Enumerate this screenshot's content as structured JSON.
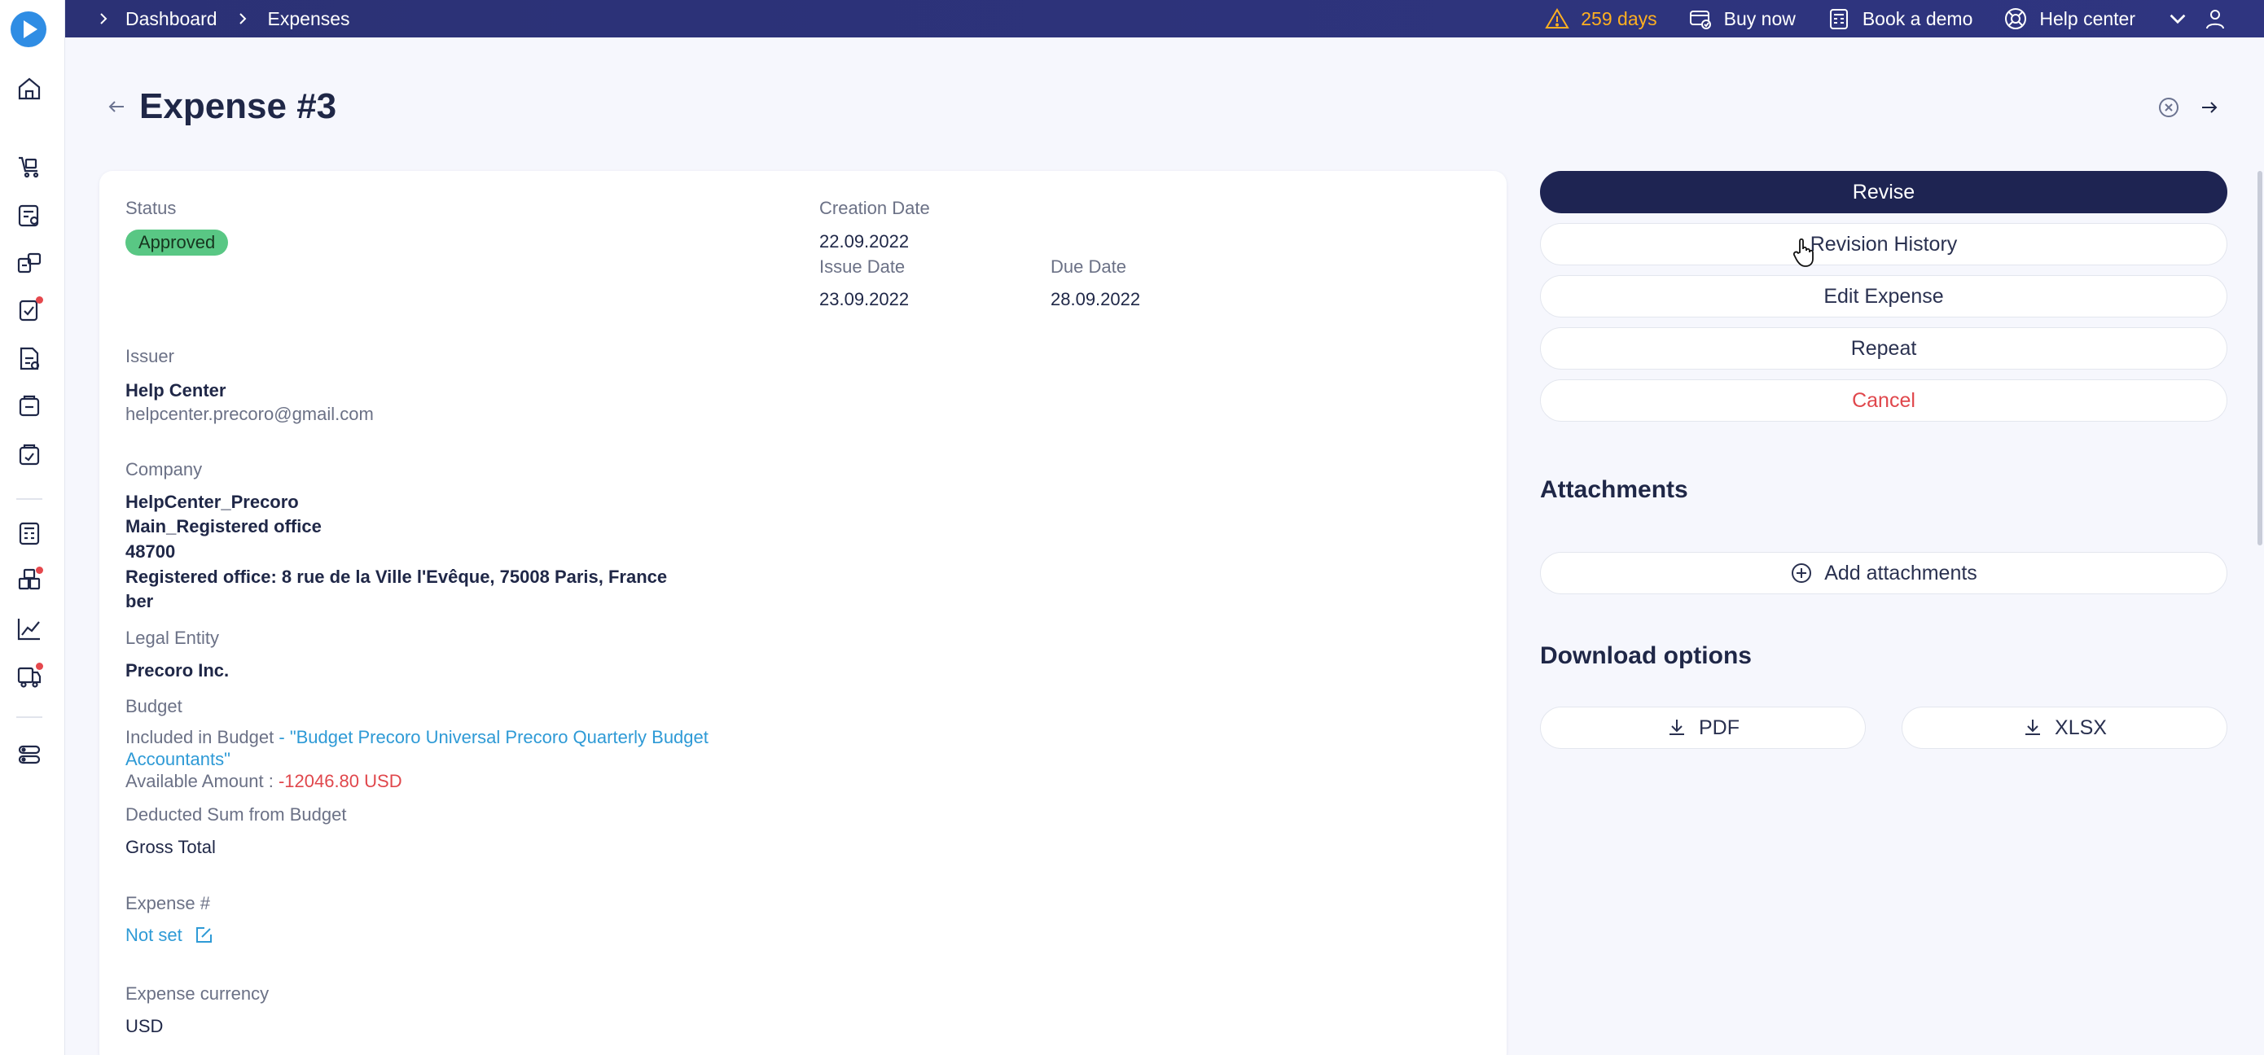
{
  "breadcrumbs": [
    "Dashboard",
    "Expenses"
  ],
  "topbar": {
    "trial_days": "259 days",
    "buy_now": "Buy now",
    "book_demo": "Book a demo",
    "help_center": "Help center"
  },
  "page": {
    "title": "Expense #3"
  },
  "details": {
    "status_label": "Status",
    "status_value": "Approved",
    "creation_date_label": "Creation Date",
    "creation_date": "22.09.2022",
    "issue_date_label": "Issue Date",
    "issue_date": "23.09.2022",
    "due_date_label": "Due Date",
    "due_date": "28.09.2022",
    "issuer_label": "Issuer",
    "issuer_name": "Help Center",
    "issuer_email": "helpcenter.precoro@gmail.com",
    "company_label": "Company",
    "company_lines": [
      "HelpCenter_Precoro",
      "Main_Registered office",
      "48700",
      "Registered office: 8 rue de la Ville l'Evêque, 75008 Paris, France",
      "ber"
    ],
    "legal_entity_label": "Legal Entity",
    "legal_entity": "Precoro Inc.",
    "budget_label": "Budget",
    "budget_prefix": "Included in Budget ",
    "budget_name_line1": "- \"Budget Precoro Universal Precoro Quarterly Budget",
    "budget_name_line2": "Accountants\"",
    "available_label": "Available Amount : ",
    "available_amount": "-12046.80 USD",
    "deducted_label": "Deducted Sum from Budget",
    "deducted_value": "Gross Total",
    "expense_no_label": "Expense #",
    "expense_no_value": "Not set",
    "currency_label": "Expense currency",
    "currency_value": "USD"
  },
  "actions": {
    "revise": "Revise",
    "revision_history": "Revision History",
    "edit": "Edit Expense",
    "repeat": "Repeat",
    "cancel": "Cancel"
  },
  "attachments": {
    "title": "Attachments",
    "add": "Add attachments"
  },
  "downloads": {
    "title": "Download options",
    "pdf": "PDF",
    "xlsx": "XLSX"
  },
  "colors": {
    "accent": "#1e2452",
    "approved": "#59c784",
    "link": "#2e9ad6",
    "danger": "#e0474c",
    "warning": "#ffb020"
  }
}
